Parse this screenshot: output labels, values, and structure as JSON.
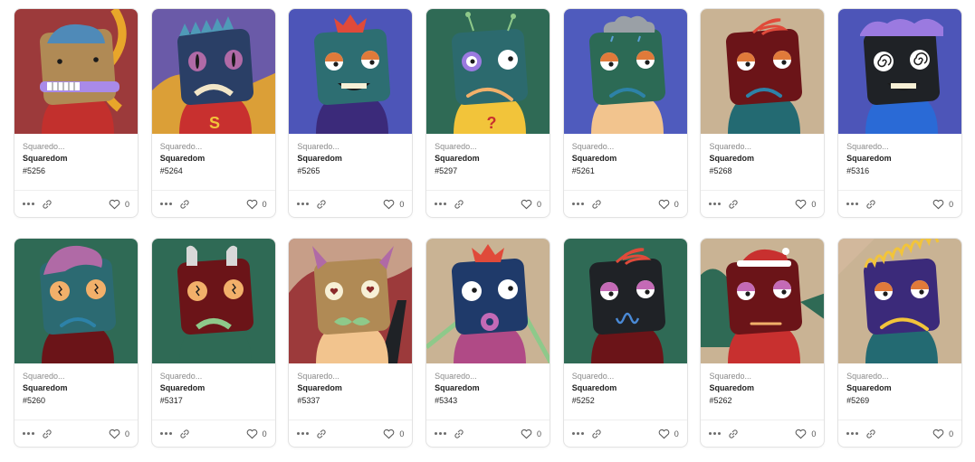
{
  "cards": [
    {
      "collection": "Squaredo...",
      "name": "Squaredom",
      "token": "#5256",
      "likes": "0",
      "bg": "#9c3a3b",
      "face": "#b08a55",
      "body": "#c2302d",
      "eyeL": "dot",
      "eyeR": "dot",
      "mouth": "teeth-purple",
      "hair": "blue",
      "accent": "#e8a62a"
    },
    {
      "collection": "Squaredo...",
      "name": "Squaredom",
      "token": "#5264",
      "likes": "0",
      "bg": "#6a5aa8",
      "face": "#2a3f66",
      "body": "#c8302f",
      "eyeL": "slit",
      "eyeR": "slit",
      "mouth": "frown-teeth",
      "hair": "spikes-blue",
      "accent": "#e8a62a"
    },
    {
      "collection": "Squaredo...",
      "name": "Squaredom",
      "token": "#5265",
      "likes": "0",
      "bg": "#4d55b8",
      "face": "#2d6e72",
      "body": "#3b2a7a",
      "eyeL": "sleepy",
      "eyeR": "sleepy",
      "mouth": "grin",
      "hair": "crown",
      "accent": "#e04a3a"
    },
    {
      "collection": "Squaredo...",
      "name": "Squaredom",
      "token": "#5297",
      "likes": "0",
      "bg": "#2f6a55",
      "face": "#2c6a6e",
      "body": "#f2c43a",
      "eyeL": "purple",
      "eyeR": "wide",
      "mouth": "sad-line",
      "hair": "antenna",
      "accent": "#d43a2a"
    },
    {
      "collection": "Squaredo...",
      "name": "Squaredom",
      "token": "#5261",
      "likes": "0",
      "bg": "#4f5bbd",
      "face": "#2c6a55",
      "body": "#f2c48e",
      "eyeL": "sleepy",
      "eyeR": "sleepy",
      "mouth": "frown",
      "hair": "cloud",
      "accent": "#9aa0a6"
    },
    {
      "collection": "Squaredo...",
      "name": "Squaredom",
      "token": "#5268",
      "likes": "0",
      "bg": "#c9b394",
      "face": "#6b1418",
      "body": "#236a72",
      "eyeL": "sleepy",
      "eyeR": "sleepy",
      "mouth": "frown",
      "hair": "swirl-red",
      "accent": "#e04a3a"
    },
    {
      "collection": "Squaredo...",
      "name": "Squaredom",
      "token": "#5316",
      "likes": "0",
      "bg": "#4d55b8",
      "face": "#1f2226",
      "body": "#2a6ad6",
      "eyeL": "spiral",
      "eyeR": "spiral",
      "mouth": "grin",
      "hair": "purple-wave",
      "accent": "#9b7ae0"
    },
    {
      "collection": "Squaredo...",
      "name": "Squaredom",
      "token": "#5260",
      "likes": "0",
      "bg": "#2f6a55",
      "face": "#2c6a72",
      "body": "#6b1418",
      "eyeL": "orange",
      "eyeR": "orange",
      "mouth": "frown",
      "hair": "purple-tuft",
      "accent": "#b06aa6"
    },
    {
      "collection": "Squaredo...",
      "name": "Squaredom",
      "token": "#5317",
      "likes": "0",
      "bg": "#2f6a55",
      "face": "#6b1418",
      "body": "#2f6a55",
      "eyeL": "orange",
      "eyeR": "orange",
      "mouth": "frown-teeth-green",
      "hair": "ears",
      "accent": "#d8d8d8"
    },
    {
      "collection": "Squaredo...",
      "name": "Squaredom",
      "token": "#5337",
      "likes": "0",
      "bg": "#9c3a3b",
      "face": "#b08a55",
      "body": "#f2c48e",
      "eyeL": "heart",
      "eyeR": "heart",
      "mouth": "mustache",
      "hair": "horns",
      "accent": "#d2b89c"
    },
    {
      "collection": "Squaredo...",
      "name": "Squaredom",
      "token": "#5343",
      "likes": "0",
      "bg": "#c9b394",
      "face": "#1f3a6a",
      "body": "#b04a86",
      "eyeL": "wide",
      "eyeR": "wide",
      "mouth": "donut",
      "hair": "crown",
      "accent": "#e04a3a"
    },
    {
      "collection": "Squaredo...",
      "name": "Squaredom",
      "token": "#5252",
      "likes": "0",
      "bg": "#2f6a55",
      "face": "#1f2226",
      "body": "#6b1418",
      "eyeL": "pink-sleepy",
      "eyeR": "pink-sleepy",
      "mouth": "squiggle",
      "hair": "swirl-red",
      "accent": "#e04a3a"
    },
    {
      "collection": "Squaredo...",
      "name": "Squaredom",
      "token": "#5262",
      "likes": "0",
      "bg": "#c9b394",
      "face": "#6b1418",
      "body": "#c8302f",
      "eyeL": "pink-sleepy",
      "eyeR": "pink-sleepy",
      "mouth": "flat",
      "hair": "santa",
      "accent": "#c8302f"
    },
    {
      "collection": "Squaredo...",
      "name": "Squaredom",
      "token": "#5269",
      "likes": "0",
      "bg": "#c9b394",
      "face": "#3b2a7a",
      "body": "#236a72",
      "eyeL": "sleepy",
      "eyeR": "sleepy",
      "mouth": "frown-yellow",
      "hair": "yellow-wave",
      "accent": "#f2c43a"
    }
  ]
}
